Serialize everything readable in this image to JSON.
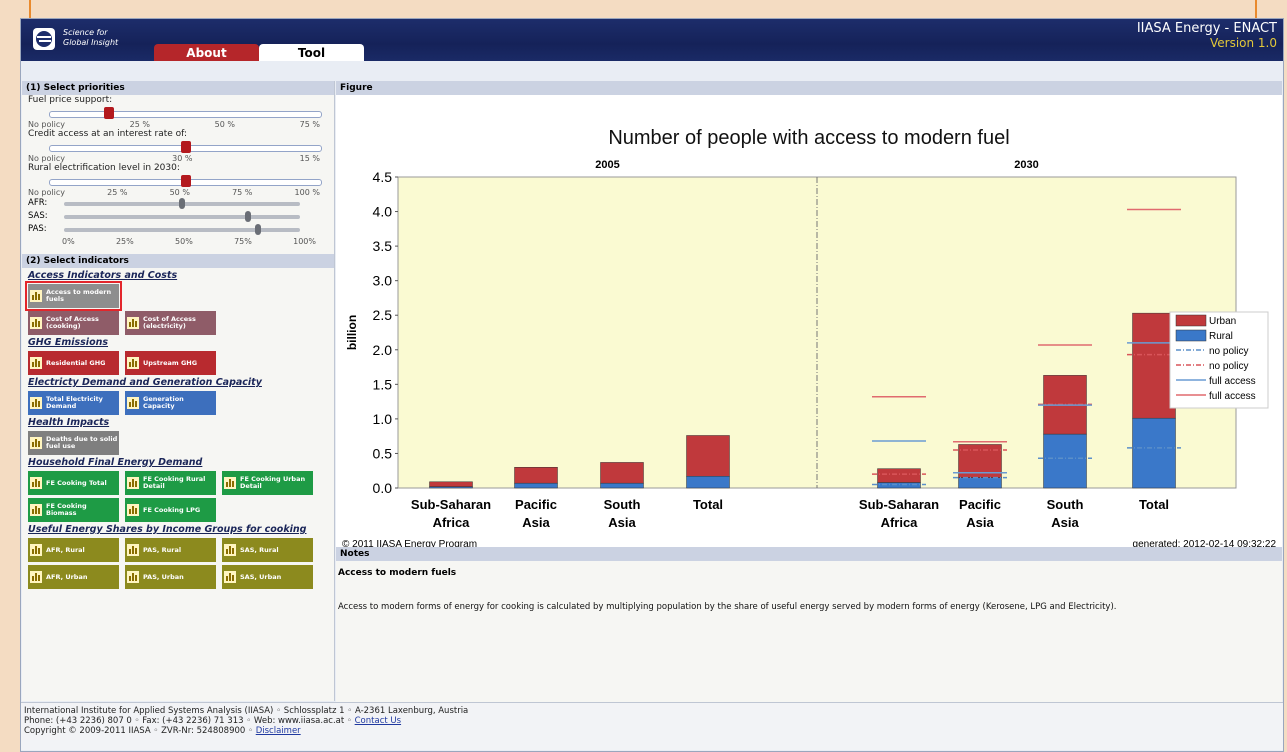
{
  "header": {
    "logo_line1": "Science for",
    "logo_line2": "Global Insight",
    "tab_about": "About",
    "tab_tool": "Tool",
    "brand": "IIASA Energy - ENACT",
    "version": "Version 1.0"
  },
  "left": {
    "priorities_title": "(1) Select priorities",
    "fuel_label": "Fuel price support:",
    "fuel_ticks": [
      "No policy",
      "25 %",
      "50 %",
      "75 %"
    ],
    "fuel_value": 0.22,
    "credit_label": "Credit access at an interest rate of:",
    "credit_ticks": [
      "No policy",
      "30 %",
      "15 %"
    ],
    "credit_value": 0.5,
    "rural_label": "Rural electrification level in 2030:",
    "rural_ticks": [
      "No policy",
      "25 %",
      "50 %",
      "75 %",
      "100 %"
    ],
    "rural_value": 0.5,
    "regions": [
      {
        "name": "AFR:",
        "value": 0.5
      },
      {
        "name": "SAS:",
        "value": 0.78
      },
      {
        "name": "PAS:",
        "value": 0.82
      }
    ],
    "region_ticks": [
      "0%",
      "25%",
      "50%",
      "75%",
      "100%"
    ],
    "indicators_title": "(2) Select indicators",
    "groups": [
      {
        "title": "Access Indicators and Costs",
        "rows": [
          [
            {
              "label": "Access to modern fuels",
              "color": "gray",
              "selected": true
            }
          ],
          [
            {
              "label": "Cost of Access (cooking)",
              "color": "maroon"
            },
            {
              "label": "Cost of Access (electricity)",
              "color": "maroon"
            }
          ]
        ]
      },
      {
        "title": "GHG Emissions",
        "rows": [
          [
            {
              "label": "Residential GHG",
              "color": "red"
            },
            {
              "label": "Upstream GHG",
              "color": "red"
            }
          ]
        ]
      },
      {
        "title": "Electricty Demand and Generation Capacity",
        "rows": [
          [
            {
              "label": "Total Electricity Demand",
              "color": "blue"
            },
            {
              "label": "Generation Capacity",
              "color": "blue"
            }
          ]
        ]
      },
      {
        "title": "Health Impacts",
        "rows": [
          [
            {
              "label": "Deaths due to solid fuel use",
              "color": "gray2"
            }
          ]
        ]
      },
      {
        "title": "Household Final Energy Demand",
        "rows": [
          [
            {
              "label": "FE Cooking Total",
              "color": "green"
            },
            {
              "label": "FE Cooking Rural Detail",
              "color": "green"
            },
            {
              "label": "FE Cooking Urban Detail",
              "color": "green"
            }
          ],
          [
            {
              "label": "FE Cooking Biomass",
              "color": "green"
            },
            {
              "label": "FE Cooking LPG",
              "color": "green"
            }
          ]
        ]
      },
      {
        "title": "Useful Energy Shares by Income Groups for cooking",
        "rows": [
          [
            {
              "label": "AFR, Rural",
              "color": "olive"
            },
            {
              "label": "PAS, Rural",
              "color": "olive"
            },
            {
              "label": "SAS, Rural",
              "color": "olive"
            }
          ],
          [
            {
              "label": "AFR, Urban",
              "color": "olive"
            },
            {
              "label": "PAS, Urban",
              "color": "olive"
            },
            {
              "label": "SAS, Urban",
              "color": "olive"
            }
          ]
        ]
      }
    ]
  },
  "figure": {
    "header": "Figure",
    "copyright": "© 2011 IIASA Energy Program",
    "generated": "generated: 2012-02-14 09:32:22"
  },
  "chart_data": {
    "type": "bar",
    "title": "Number of people with access to modern fuel",
    "ylabel": "billion",
    "ylim": [
      0,
      4.5
    ],
    "yticks": [
      "0.0",
      "0.5",
      "1.0",
      "1.5",
      "2.0",
      "2.5",
      "3.0",
      "3.5",
      "4.0",
      "4.5"
    ],
    "panels": [
      "2005",
      "2030"
    ],
    "categories": [
      "Sub-Saharan Africa",
      "Pacific Asia",
      "South Asia",
      "Total"
    ],
    "series": [
      {
        "name": "Rural",
        "values_2005": [
          0.02,
          0.07,
          0.07,
          0.17
        ],
        "values_2030": [
          0.08,
          0.15,
          0.78,
          1.01
        ],
        "color": "#3a78c9"
      },
      {
        "name": "Urban",
        "values_2005": [
          0.07,
          0.23,
          0.3,
          0.59
        ],
        "values_2030": [
          0.2,
          0.48,
          0.85,
          1.52
        ],
        "color": "#c0393c"
      }
    ],
    "lines_2030": {
      "no_policy_rural": [
        0.05,
        0.15,
        0.43,
        0.58
      ],
      "no_policy_urban": [
        0.2,
        0.55,
        1.21,
        1.93
      ],
      "full_access_rural": [
        0.68,
        0.22,
        1.2,
        2.1
      ],
      "full_access_urban": [
        1.32,
        0.67,
        2.07,
        4.03
      ]
    },
    "legend": [
      "Urban",
      "Rural",
      "no policy",
      "no policy",
      "full access",
      "full access"
    ]
  },
  "notes": {
    "header": "Notes",
    "title": "Access to modern fuels",
    "text": "Access to modern forms of energy for cooking is calculated by multiplying population by the share of useful energy served by modern forms of energy (Kerosene, LPG and Electricity)."
  },
  "footer": {
    "line1": "International Institute for Applied Systems Analysis (IIASA) ◦ Schlossplatz 1 ◦ A-2361 Laxenburg, Austria",
    "line2": "Phone: (+43 2236) 807 0 ◦ Fax: (+43 2236) 71 313 ◦ Web: www.iiasa.ac.at ◦ ",
    "contact": "Contact Us",
    "line3": "Copyright © 2009-2011 IIASA ◦ ZVR-Nr: 524808900 ◦ ",
    "disclaimer": "Disclaimer"
  }
}
